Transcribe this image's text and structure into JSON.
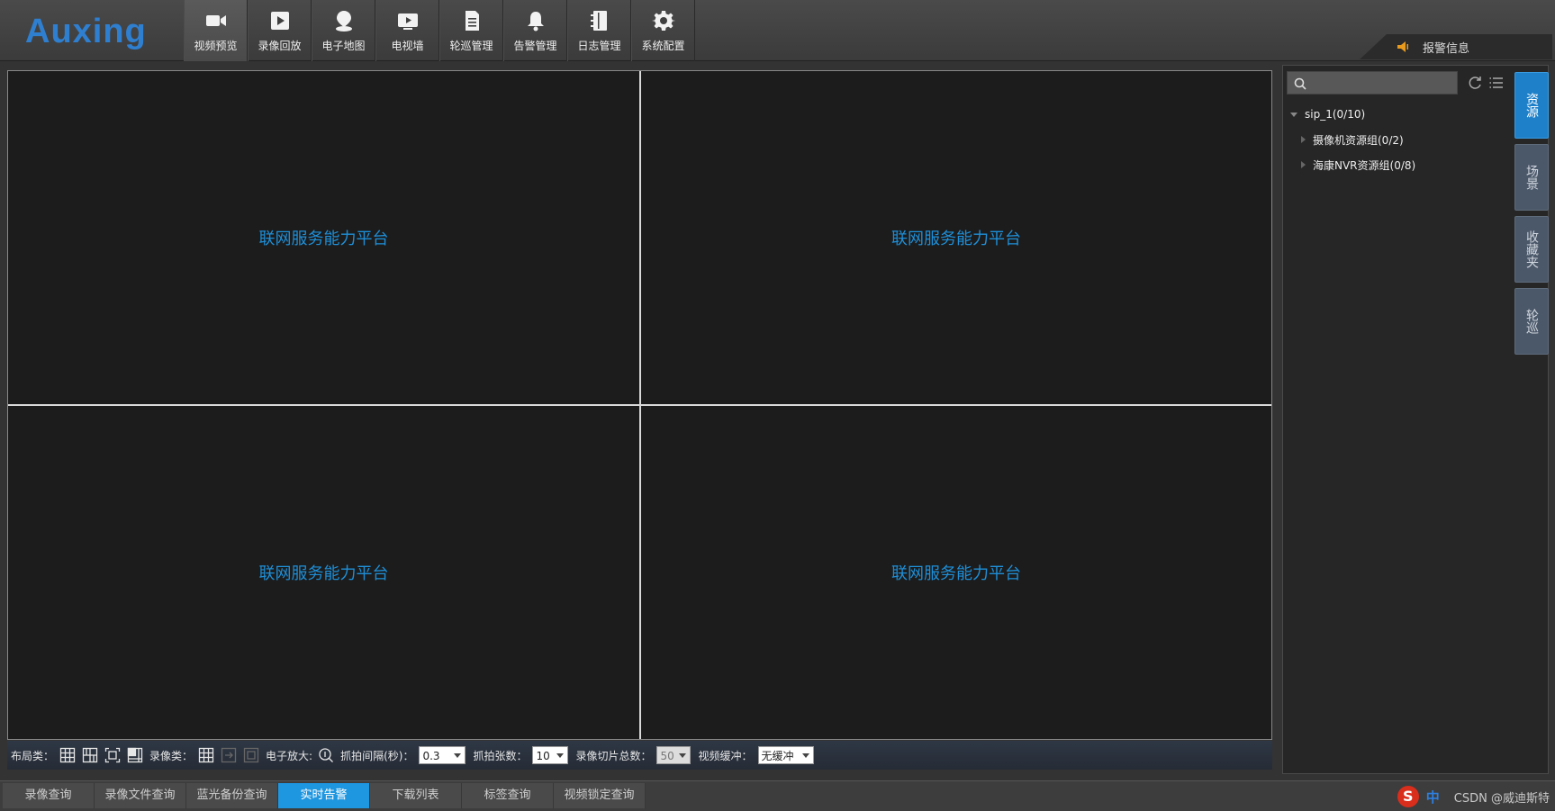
{
  "header": {
    "logo_text": "Auxing",
    "logo_small": "—",
    "nav": [
      {
        "label": "视频预览",
        "icon": "camera-icon",
        "active": true
      },
      {
        "label": "录像回放",
        "icon": "play-icon"
      },
      {
        "label": "电子地图",
        "icon": "map-pin-icon"
      },
      {
        "label": "电视墙",
        "icon": "tv-icon"
      },
      {
        "label": "轮巡管理",
        "icon": "document-icon"
      },
      {
        "label": "告警管理",
        "icon": "bell-icon"
      },
      {
        "label": "日志管理",
        "icon": "notebook-icon"
      },
      {
        "label": "系统配置",
        "icon": "gear-icon"
      }
    ],
    "alarm_label": "报警信息"
  },
  "video": {
    "cells": [
      "联网服务能力平台",
      "联网服务能力平台",
      "联网服务能力平台",
      "联网服务能力平台"
    ]
  },
  "toolbar": {
    "layout_label": "布局类：",
    "record_label": "录像类：",
    "zoom_label": "电子放大:",
    "interval_label": "抓拍间隔(秒)：",
    "interval_value": "0.3",
    "count_label": "抓拍张数：",
    "count_value": "10",
    "slice_label": "录像切片总数：",
    "slice_value": "50",
    "buffer_label": "视频缓冲：",
    "buffer_value": "无缓冲"
  },
  "tabs": [
    "录像查询",
    "录像文件查询",
    "蓝光备份查询",
    "实时告警",
    "下载列表",
    "标签查询",
    "视频锁定查询"
  ],
  "active_tab": 3,
  "tray": {
    "s": "S",
    "zh": "中",
    "watermark": "CSDN @威迪斯特"
  },
  "panel": {
    "search_placeholder": "",
    "tree": {
      "root": "sip_1(0/10)",
      "children": [
        "摄像机资源组(0/2)",
        "海康NVR资源组(0/8)"
      ]
    },
    "side_tabs": [
      "资源",
      "场景",
      "收藏夹",
      "轮巡"
    ]
  },
  "colors": {
    "accent": "#1e96e0",
    "video_text": "#1e8fd8",
    "alarm_icon": "#e89a1e"
  }
}
